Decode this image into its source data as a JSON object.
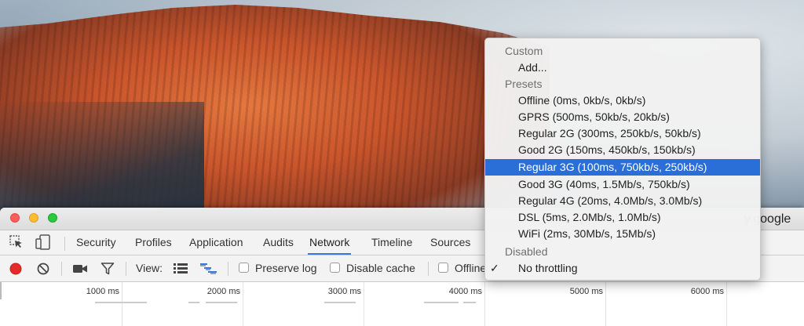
{
  "window": {
    "url_fragment": "y.google"
  },
  "tabs": [
    {
      "label": "Security"
    },
    {
      "label": "Profiles"
    },
    {
      "label": "Application"
    },
    {
      "label": "Audits"
    },
    {
      "label": "Network",
      "active": true
    },
    {
      "label": "Timeline"
    },
    {
      "label": "Sources"
    }
  ],
  "toolbar": {
    "view_label": "View:",
    "preserve_log": {
      "label": "Preserve log",
      "checked": false
    },
    "disable_cache": {
      "label": "Disable cache",
      "checked": false
    },
    "offline": {
      "label": "Offline",
      "checked": false
    }
  },
  "timeline": {
    "ticks": [
      "1000 ms",
      "2000 ms",
      "3000 ms",
      "4000 ms",
      "5000 ms",
      "6000 ms"
    ]
  },
  "throttle_menu": {
    "custom_header": "Custom",
    "add": "Add...",
    "presets_header": "Presets",
    "presets": [
      "Offline (0ms, 0kb/s, 0kb/s)",
      "GPRS (500ms, 50kb/s, 20kb/s)",
      "Regular 2G (300ms, 250kb/s, 50kb/s)",
      "Good 2G (150ms, 450kb/s, 150kb/s)",
      "Regular 3G (100ms, 750kb/s, 250kb/s)",
      "Good 3G (40ms, 1.5Mb/s, 750kb/s)",
      "Regular 4G (20ms, 4.0Mb/s, 3.0Mb/s)",
      "DSL (5ms, 2.0Mb/s, 1.0Mb/s)",
      "WiFi (2ms, 30Mb/s, 15Mb/s)"
    ],
    "highlighted_preset": "Regular 3G (100ms, 750kb/s, 250kb/s)",
    "disabled_header": "Disabled",
    "no_throttling": "No throttling",
    "checked_item": "No throttling",
    "check_glyph": "✓"
  },
  "colors": {
    "accent": "#3879d9",
    "selection": "#2a6fd8",
    "record": "#e32b2b",
    "filter_active": "#3879d9"
  }
}
